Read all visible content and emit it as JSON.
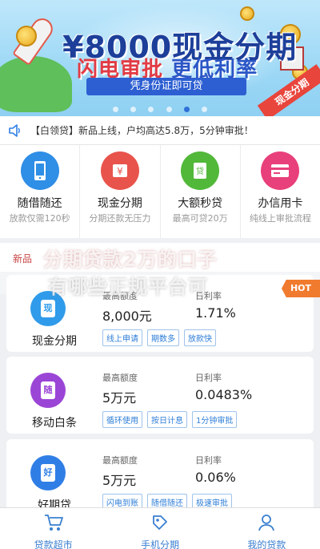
{
  "banner": {
    "headline": "¥8000现金分期",
    "subline_a": "闪电审批",
    "subline_b": "更低利率",
    "ribbon": "凭身份证即可贷",
    "corner_tag": "现金分期",
    "active_dot": 4,
    "dot_count": 6
  },
  "notice": {
    "icon": "speaker-icon",
    "text": "【白领贷】新品上线，户均高达5.8万，5分钟审批！"
  },
  "quick_links": [
    {
      "title": "随借随还",
      "sub": "放款仅需120秒",
      "icon": "phone-icon",
      "color": "#2f8ee6"
    },
    {
      "title": "现金分期",
      "sub": "分期还款无压力",
      "icon": "yen-card-icon",
      "color": "#e8544c"
    },
    {
      "title": "大额秒贷",
      "sub": "最高可贷20万",
      "icon": "loan-doc-icon",
      "color": "#52b83a"
    },
    {
      "title": "办信用卡",
      "sub": "纯线上审批流程",
      "icon": "credit-card-icon",
      "color": "#e8407a"
    }
  ],
  "section": {
    "label": "新品",
    "overlay_line1": "分期贷款2万的口子",
    "overlay_line2": "有哪些正规平台可"
  },
  "products": [
    {
      "name": "现金分期",
      "logo_char": "现",
      "logo_color": "#2f9bea",
      "amount_label": "最高额度",
      "amount": "8,000元",
      "rate_label": "日利率",
      "rate": "1.71%",
      "tags": [
        "线上申请",
        "期数多",
        "放款快"
      ],
      "hot": "HOT"
    },
    {
      "name": "移动白条",
      "logo_char": "随",
      "logo_color": "#9b45d6",
      "amount_label": "最高额度",
      "amount": "5万元",
      "rate_label": "日利率",
      "rate": "0.0483%",
      "tags": [
        "循环使用",
        "按日计息",
        "1分钟审批"
      ]
    },
    {
      "name": "好期贷",
      "logo_char": "好",
      "logo_color": "#2f7ee6",
      "amount_label": "最高额度",
      "amount": "5万元",
      "rate_label": "日利率",
      "rate": "0.06%",
      "tags": [
        "闪电到账",
        "随借随还",
        "极速审批"
      ]
    }
  ],
  "bottom_nav": [
    {
      "label": "贷款超市",
      "icon": "cart-icon"
    },
    {
      "label": "手机分期",
      "icon": "tag-icon"
    },
    {
      "label": "我的贷款",
      "icon": "user-icon"
    }
  ]
}
